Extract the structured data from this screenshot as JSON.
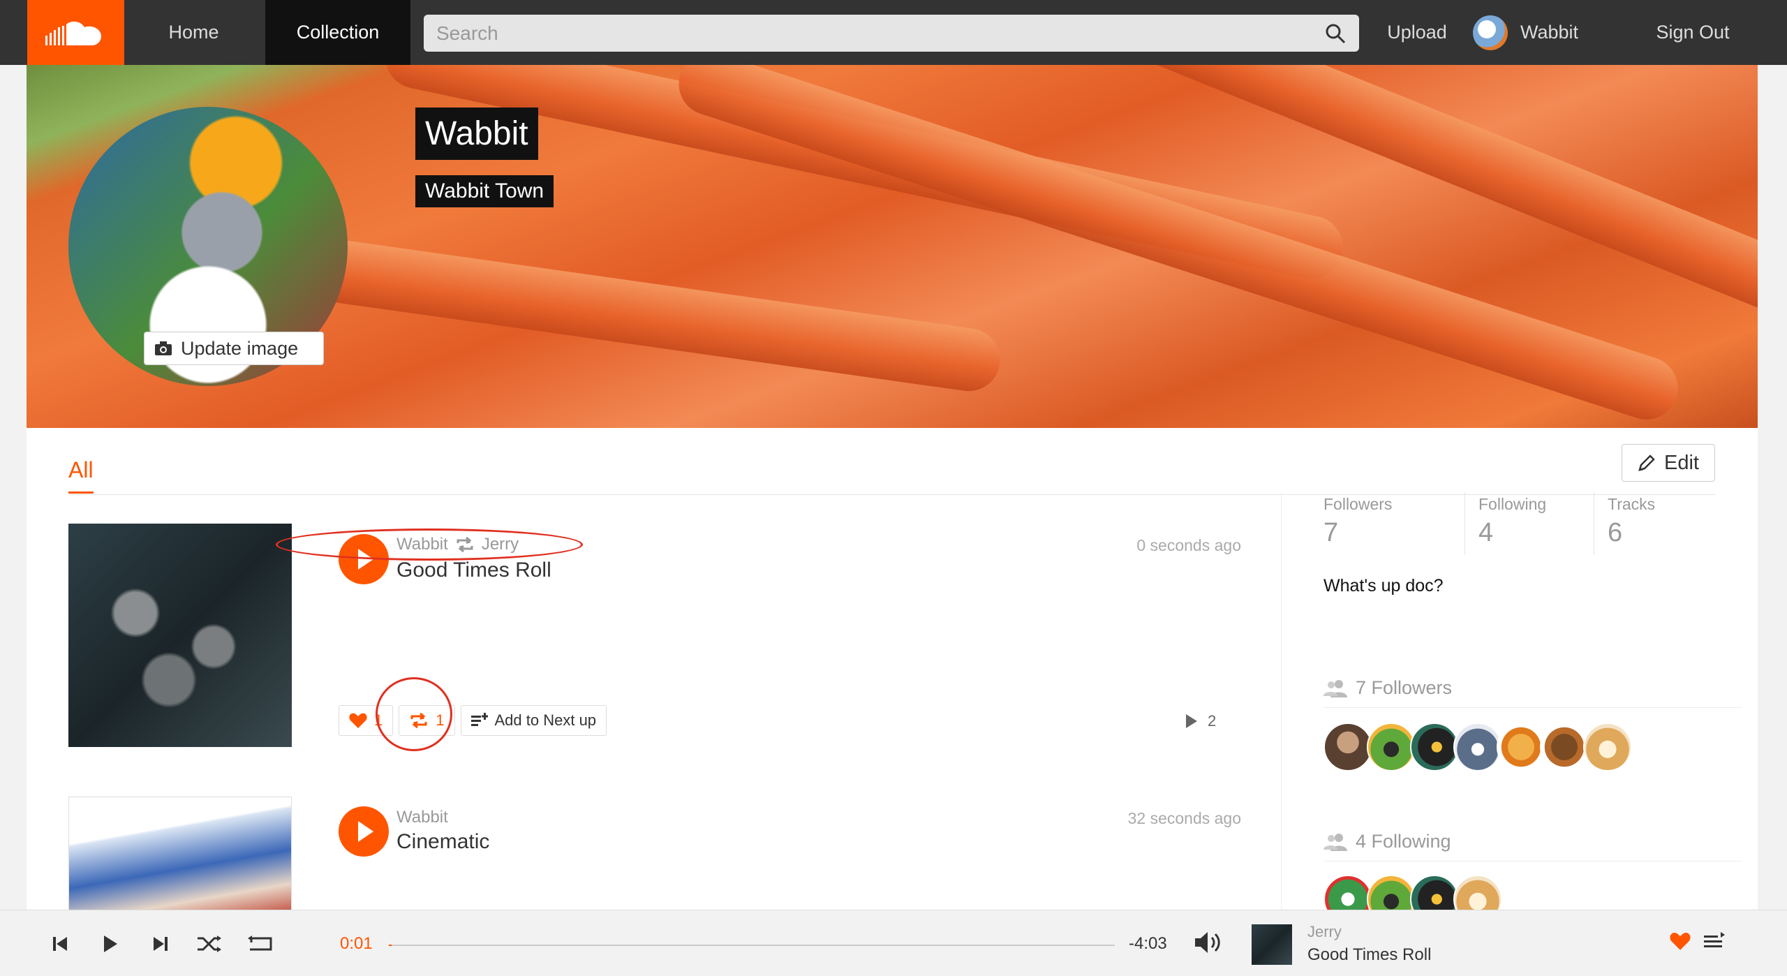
{
  "nav": {
    "logo": "cloud-logo",
    "home": "Home",
    "collection": "Collection",
    "search_placeholder": "Search",
    "upload": "Upload",
    "user": "Wabbit",
    "signout": "Sign Out"
  },
  "profile": {
    "name": "Wabbit",
    "location": "Wabbit Town",
    "update_image": "Update image"
  },
  "tabs": {
    "all": "All",
    "edit": "Edit"
  },
  "tracks": [
    {
      "user": "Wabbit",
      "reposted_from": "Jerry",
      "title": "Good Times Roll",
      "time": "0 seconds ago",
      "likes": "1",
      "reposts": "1",
      "add_next": "Add to Next up",
      "plays": "2"
    },
    {
      "user": "Wabbit",
      "title": "Cinematic",
      "time": "32 seconds ago"
    }
  ],
  "sidebar": {
    "stats": [
      {
        "label": "Followers",
        "value": "7"
      },
      {
        "label": "Following",
        "value": "4"
      },
      {
        "label": "Tracks",
        "value": "6"
      }
    ],
    "bio": "What's up doc?",
    "followers_heading": "7 Followers",
    "following_heading": "4 Following"
  },
  "player": {
    "current_time": "0:01",
    "remaining_time": "-4:03",
    "progress": 0.004,
    "artist": "Jerry",
    "title": "Good Times Roll"
  },
  "colors": {
    "accent": "#ff5500",
    "annotation": "#e03020"
  }
}
